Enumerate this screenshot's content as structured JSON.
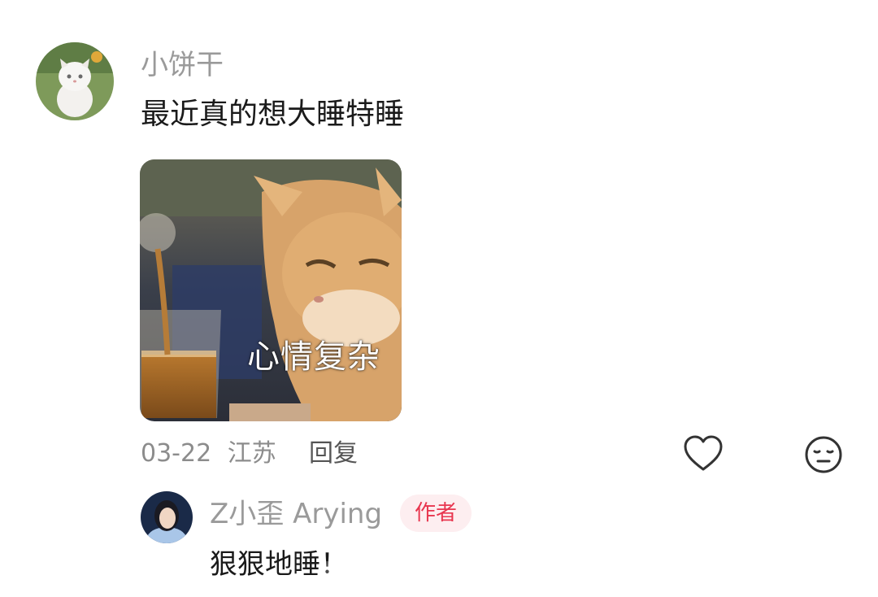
{
  "comment": {
    "username": "小饼干",
    "text": "最近真的想大睡特睡",
    "sticker_caption": "心情复杂",
    "date": "03-22",
    "location": "江苏",
    "reply_label": "回复",
    "like_icon": "heart-outline-icon",
    "emoji_icon": "neutral-face-icon"
  },
  "reply": {
    "username": "Z小歪 Arying",
    "badge": "作者",
    "text": "狠狠地睡！"
  },
  "colors": {
    "username": "#9a9a9a",
    "badge_bg": "#fdeef0",
    "badge_text": "#e8364f"
  }
}
